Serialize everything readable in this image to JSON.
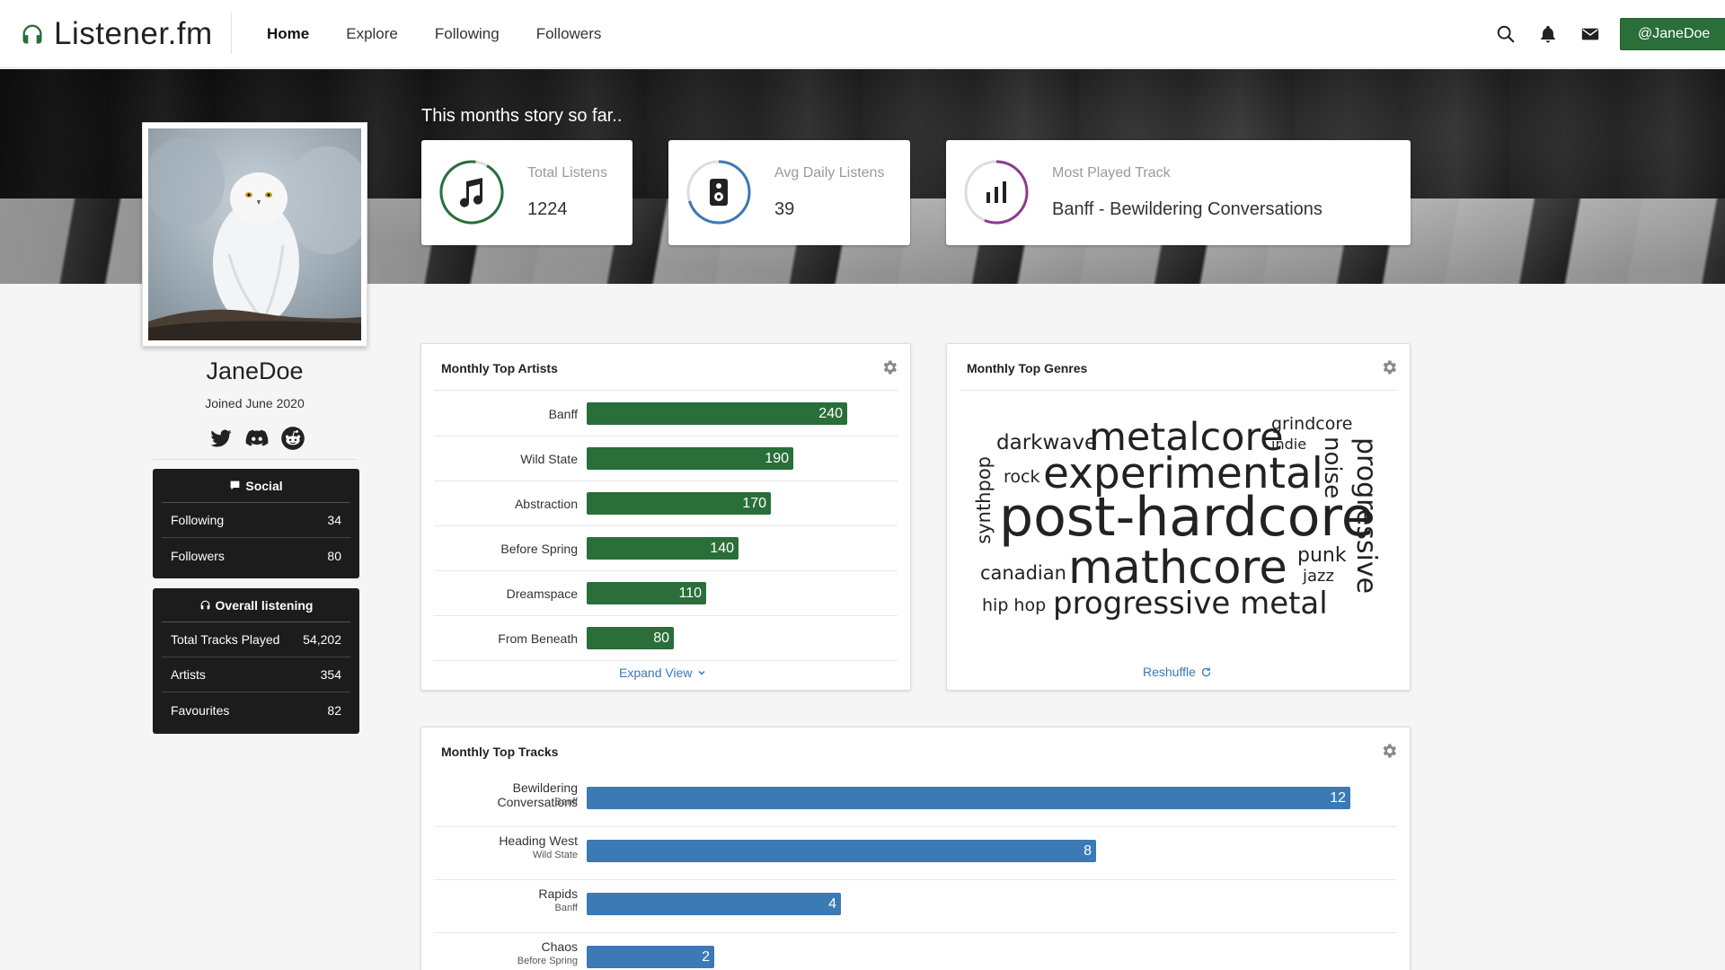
{
  "brand": {
    "name": "Listener.fm"
  },
  "nav": {
    "links": [
      "Home",
      "Explore",
      "Following",
      "Followers"
    ],
    "active": "Home"
  },
  "user_button": {
    "label": "@JaneDoe"
  },
  "hero": {
    "title": "This months story so far..",
    "stats": [
      {
        "label": "Total Listens",
        "value": "1224",
        "icon": "music-note-icon",
        "color": "#2a6e3a"
      },
      {
        "label": "Avg Daily Listens",
        "value": "39",
        "icon": "speaker-icon",
        "color": "#3b7ab4"
      },
      {
        "label": "Most Played Track",
        "value": "Banff - Bewildering Conversations",
        "icon": "bar-chart-icon",
        "color": "#8e3a8e"
      }
    ]
  },
  "profile": {
    "username": "JaneDoe",
    "joined": "Joined June 2020",
    "socials": [
      "twitter-icon",
      "discord-icon",
      "reddit-icon"
    ]
  },
  "social_panel": {
    "title": "Social",
    "rows": [
      {
        "label": "Following",
        "value": "34"
      },
      {
        "label": "Followers",
        "value": "80"
      }
    ]
  },
  "overall_panel": {
    "title": "Overall listening",
    "rows": [
      {
        "label": "Total Tracks Played",
        "value": "54,202"
      },
      {
        "label": "Artists",
        "value": "354"
      },
      {
        "label": "Favourites",
        "value": "82"
      }
    ]
  },
  "top_artists": {
    "title": "Monthly Top Artists",
    "expand_label": "Expand View",
    "color": "#2a6e3a"
  },
  "top_genres": {
    "title": "Monthly Top Genres",
    "reshuffle_label": "Reshuffle",
    "words": [
      "darkwave",
      "metalcore",
      "grindcore",
      "indie",
      "noise",
      "progressive",
      "rock",
      "experimental",
      "synthpop",
      "post-hardcore",
      "canadian",
      "mathcore",
      "punk",
      "jazz",
      "hip hop",
      "progressive metal"
    ]
  },
  "top_tracks": {
    "title": "Monthly Top Tracks",
    "color": "#3b7ab4",
    "tracks": [
      {
        "title": "Bewildering Conversations",
        "artist": "Banff"
      },
      {
        "title": "Heading West",
        "artist": "Wild State"
      },
      {
        "title": "Rapids",
        "artist": "Banff"
      },
      {
        "title": "Chaos",
        "artist": "Before Spring"
      }
    ]
  },
  "chart_data": [
    {
      "type": "bar",
      "title": "Monthly Top Artists",
      "categories": [
        "Banff",
        "Wild State",
        "Abstraction",
        "Before Spring",
        "Dreamspace",
        "From Beneath"
      ],
      "values": [
        240,
        190,
        170,
        140,
        110,
        80
      ]
    },
    {
      "type": "bar",
      "title": "Monthly Top Tracks",
      "categories": [
        "Bewildering Conversations",
        "Heading West",
        "Rapids",
        "Chaos"
      ],
      "values": [
        12,
        8,
        4,
        2
      ]
    }
  ]
}
